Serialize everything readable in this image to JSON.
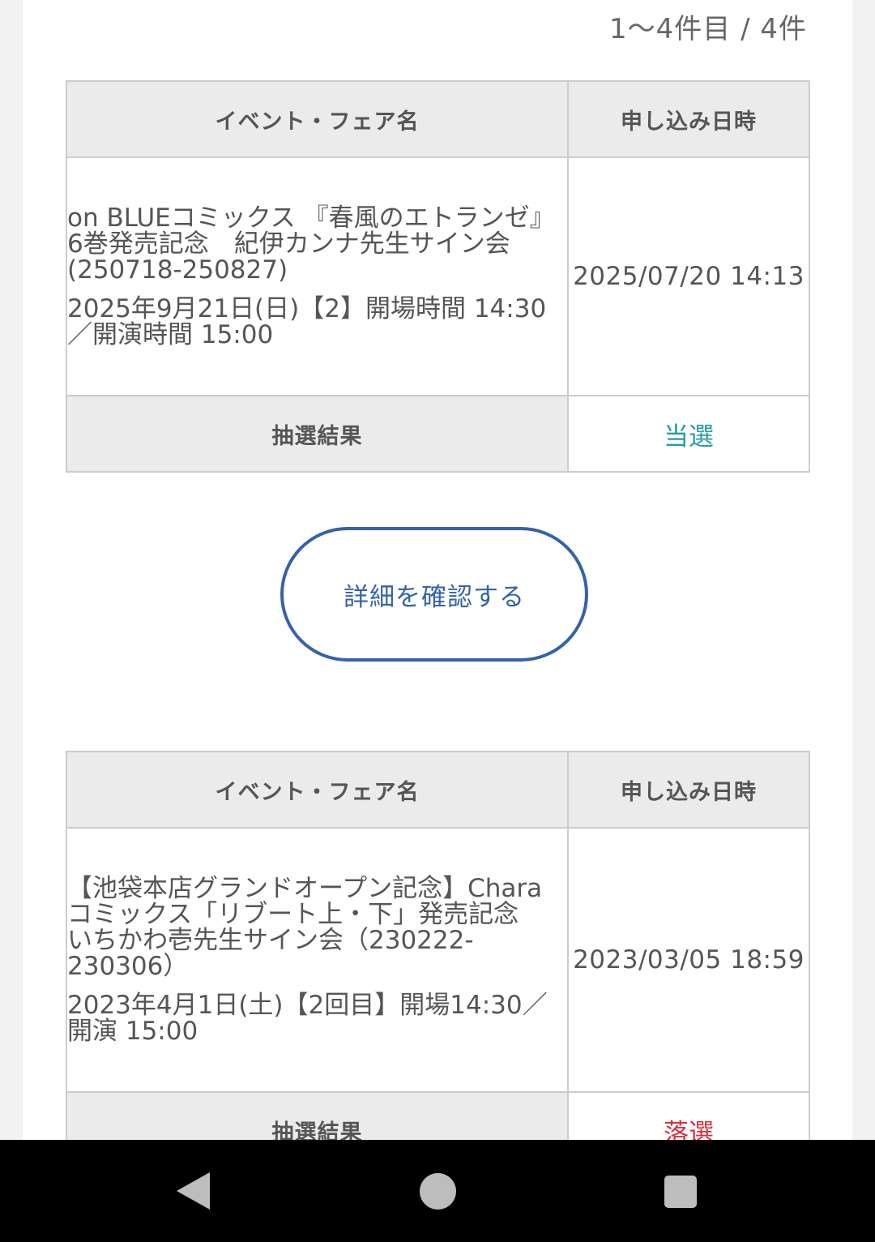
{
  "pagination": "1〜4件目 / 4件",
  "table_headers": {
    "event_name": "イベント・フェア名",
    "applied_at": "申し込み日時",
    "result_label": "抽選結果"
  },
  "entries": [
    {
      "title": "on BLUEコミックス 『春風のエトランゼ』6巻発売記念　紀伊カンナ先生サイン会(250718-250827)",
      "schedule": "2025年9月21日(日)【2】開場時間 14:30／開演時間 15:00",
      "applied_at": "2025/07/20 14:13",
      "result": "当選"
    },
    {
      "title": "【池袋本店グランドオープン記念】Charaコミックス「リブート上・下」発売記念　いちかわ壱先生サイン会（230222-230306）",
      "schedule": "2023年4月1日(土)【2回目】開場14:30／開演 15:00",
      "applied_at": "2023/03/05 18:59",
      "result": "落選"
    }
  ],
  "detail_button_label": "詳細を確認する",
  "colors": {
    "win": "#2a9ba6",
    "lose": "#d9303f",
    "button_border": "#3562a8"
  },
  "nav_icons": [
    "back-icon",
    "home-icon",
    "recent-apps-icon"
  ]
}
